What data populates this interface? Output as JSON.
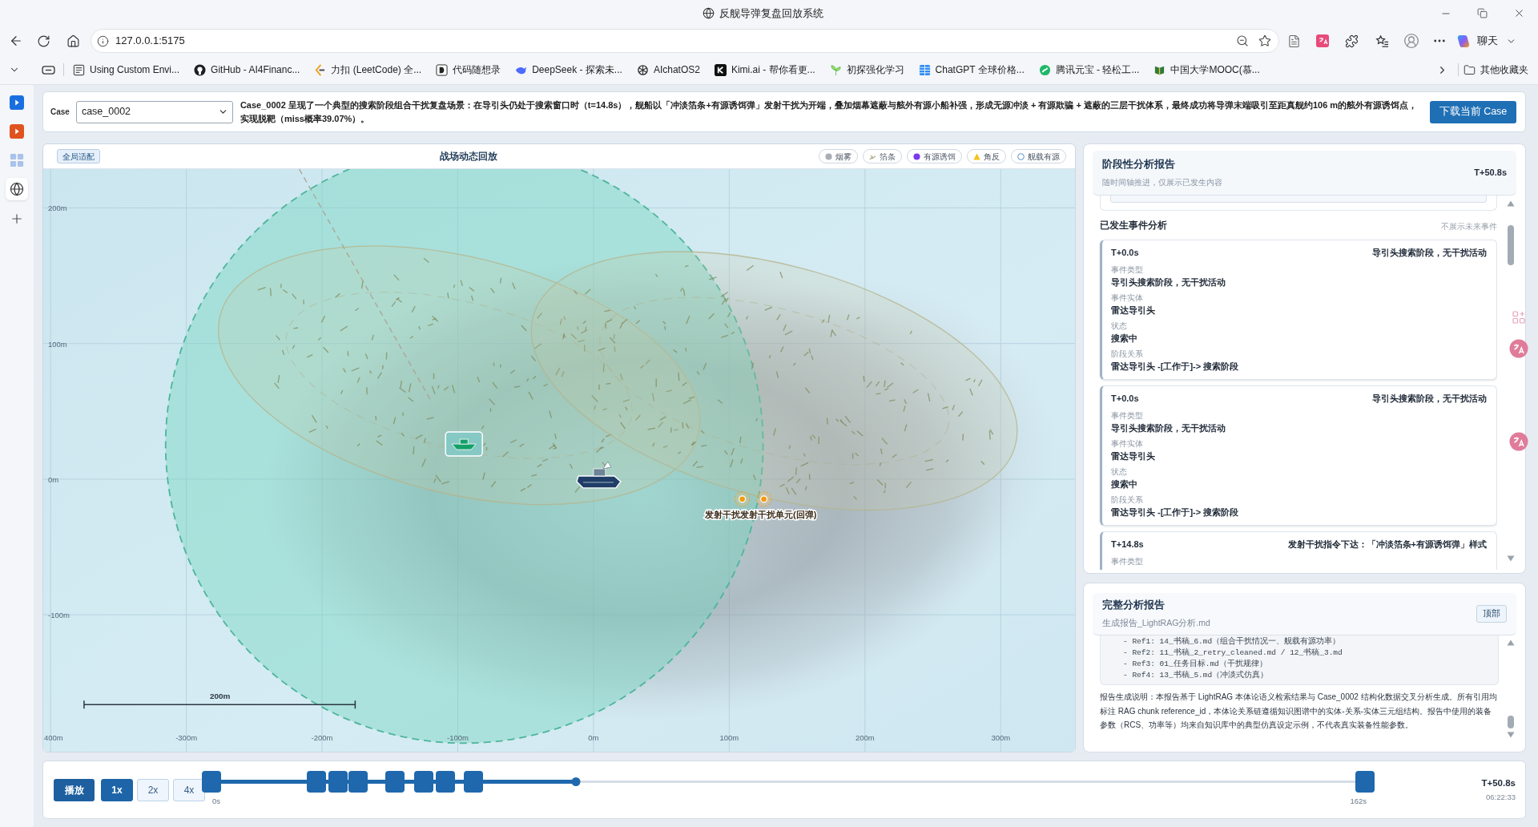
{
  "browser": {
    "title": "反舰导弹复盘回放系统",
    "url": "127.0.0.1:5175",
    "copilot_label": "聊天",
    "bookmarks": [
      "Using Custom Envi...",
      "GitHub - AI4Financ...",
      "力扣 (LeetCode) 全...",
      "代码随想录",
      "DeepSeek - 探索未...",
      "AIchatOS2",
      "Kimi.ai - 帮你看更...",
      "初探强化学习",
      "ChatGPT 全球价格...",
      "腾讯元宝 - 轻松工...",
      "中国大学MOOC(慕..."
    ],
    "other_bookmarks": "其他收藏夹"
  },
  "edge_sidebar": {
    "items": [
      {
        "kind": "play",
        "selected": false
      },
      {
        "kind": "video",
        "selected": false
      },
      {
        "kind": "grid",
        "selected": false
      },
      {
        "kind": "globe",
        "selected": true
      }
    ]
  },
  "header": {
    "case_label": "Case",
    "case_value": "case_0002",
    "summary": "Case_0002 呈现了一个典型的搜索阶段组合干扰复盘场景：在导引头仍处于搜索窗口时（t=14.8s），舰船以「冲淡箔条+有源诱饵弹」发射干扰为开端，叠加烟幕遮蔽与舷外有源小船补强，形成无源冲淡 + 有源欺骗 + 遮蔽的三层干扰体系，最终成功将导弹末端吸引至距真舰约106 m的舷外有源诱饵点，实现脱靶（miss概率39.07%）。",
    "download_button": "下载当前 Case"
  },
  "map": {
    "fit_button": "全局适配",
    "title": "战场动态回放",
    "legend": [
      {
        "kind": "smoke",
        "label": "烟雾"
      },
      {
        "kind": "chaff",
        "label": "箔条"
      },
      {
        "kind": "active_decoy",
        "label": "有源诱饵"
      },
      {
        "kind": "corner_reflector",
        "label": "角反"
      },
      {
        "kind": "shipborne_active",
        "label": "舰载有源"
      }
    ],
    "y_axis_labels": [
      "200m",
      "100m",
      "0m",
      "-100m"
    ],
    "x_axis_labels": [
      "400m",
      "-300m",
      "-200m",
      "-100m",
      "0m",
      "100m",
      "200m",
      "300m"
    ],
    "scale_bar_label": "200m",
    "jammer_label": "发射干扰发射干扰单元(回弹)"
  },
  "stage_report": {
    "title": "阶段性分析报告",
    "subtitle": "随时间轴推进，仅展示已发生内容",
    "time": "T+50.8s",
    "section_title": "已发生事件分析",
    "section_note": "不展示未来事件",
    "events": [
      {
        "time": "T+0.0s",
        "summary": "导引头搜索阶段，无干扰活动",
        "fields": [
          {
            "label": "事件类型",
            "value": "导引头搜索阶段，无干扰活动"
          },
          {
            "label": "事件实体",
            "value": "雷达导引头"
          },
          {
            "label": "状态",
            "value": "搜索中"
          },
          {
            "label": "阶段关系",
            "value": "雷达导引头 -[工作于]-> 搜索阶段"
          }
        ]
      },
      {
        "time": "T+0.0s",
        "summary": "导引头搜索阶段，无干扰活动",
        "fields": [
          {
            "label": "事件类型",
            "value": "导引头搜索阶段，无干扰活动"
          },
          {
            "label": "事件实体",
            "value": "雷达导引头"
          },
          {
            "label": "状态",
            "value": "搜索中"
          },
          {
            "label": "阶段关系",
            "value": "雷达导引头 -[工作于]-> 搜索阶段"
          }
        ]
      },
      {
        "time": "T+14.8s",
        "summary": "发射干扰指令下达：「冲淡箔条+有源诱饵弹」样式",
        "fields": [
          {
            "label": "事件类型"
          }
        ]
      }
    ]
  },
  "full_report": {
    "title": "完整分析报告",
    "file": "生成报告_LightRAG分析.md",
    "top_button": "顶部",
    "refs": [
      "- Ref1: 14_书稿_6.md（组合干扰情况一、舰载有源功率）",
      "- Ref2: 11_书稿_2_retry_cleaned.md / 12_书稿_3.md",
      "- Ref3: 01_任务目标.md（干扰规律）",
      "- Ref4: 13_书稿_5.md（冲淡式仿真）"
    ],
    "note": "报告生成说明：本报告基于 LightRAG 本体论语义检索结果与 Case_0002 结构化数据交叉分析生成。所有引用均标注 RAG chunk reference_id，本体论关系链遵循知识图谱中的实体-关系-实体三元组结构。报告中使用的装备参数（RCS、功率等）均来自知识库中的典型仿真设定示例，不代表真实装备性能参数。"
  },
  "timeline": {
    "play_button": "播放",
    "speeds": [
      {
        "label": "1x",
        "selected": true
      },
      {
        "label": "2x",
        "selected": false
      },
      {
        "label": "4x",
        "selected": false
      }
    ],
    "level": 0.316,
    "markers": [
      {
        "level": 0
      },
      {
        "level": 0.091
      },
      {
        "level": 0.11
      },
      {
        "level": 0.127
      },
      {
        "level": 0.159
      },
      {
        "level": 0.184
      },
      {
        "level": 0.203
      },
      {
        "level": 0.227
      },
      {
        "level": 1
      }
    ],
    "start_label": "0s",
    "end_label": "162s",
    "time": "T+50.8s",
    "clock": "06:22:33"
  }
}
